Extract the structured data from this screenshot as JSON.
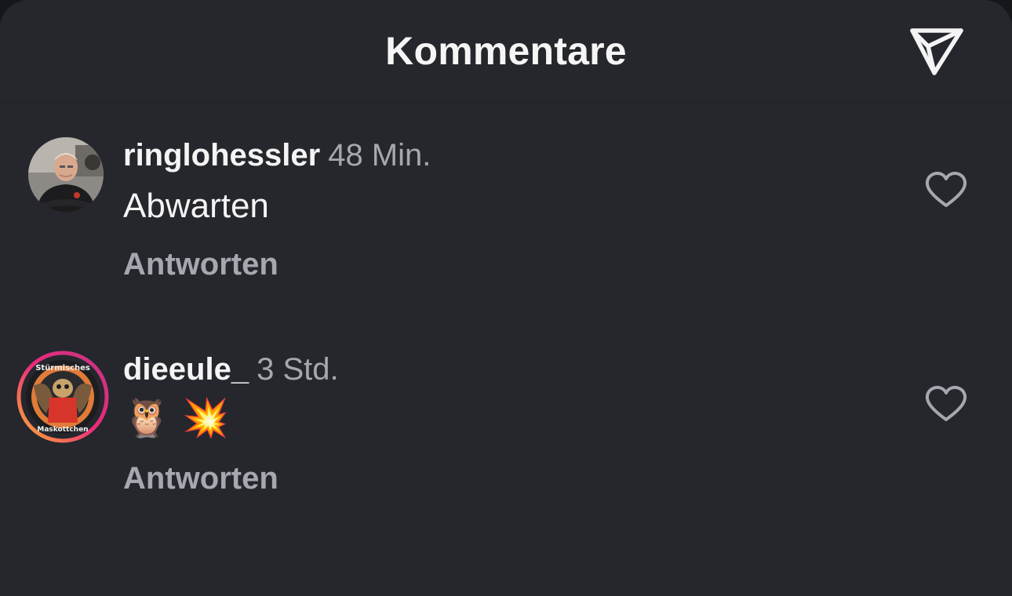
{
  "header": {
    "title": "Kommentare",
    "send_icon": "paper-plane-icon"
  },
  "comments": [
    {
      "username": "ringlohessler",
      "time": "48 Min.",
      "text": "Abwarten",
      "reply_label": "Antworten",
      "avatar": "profile-photo-man",
      "like_icon": "heart-outline-icon"
    },
    {
      "username": "dieeule_",
      "time": "3 Std.",
      "text": "🦉 💥",
      "reply_label": "Antworten",
      "avatar": "story-ring-profile-photo",
      "avatar_text": "Stürmisches Maskottchen",
      "like_icon": "heart-outline-icon"
    }
  ],
  "colors": {
    "background": "#25272d",
    "text_primary": "#f4f4f4",
    "text_secondary": "#a5a8ae",
    "story_ring": [
      "#f9b233",
      "#ee2a7b",
      "#c13584"
    ]
  }
}
